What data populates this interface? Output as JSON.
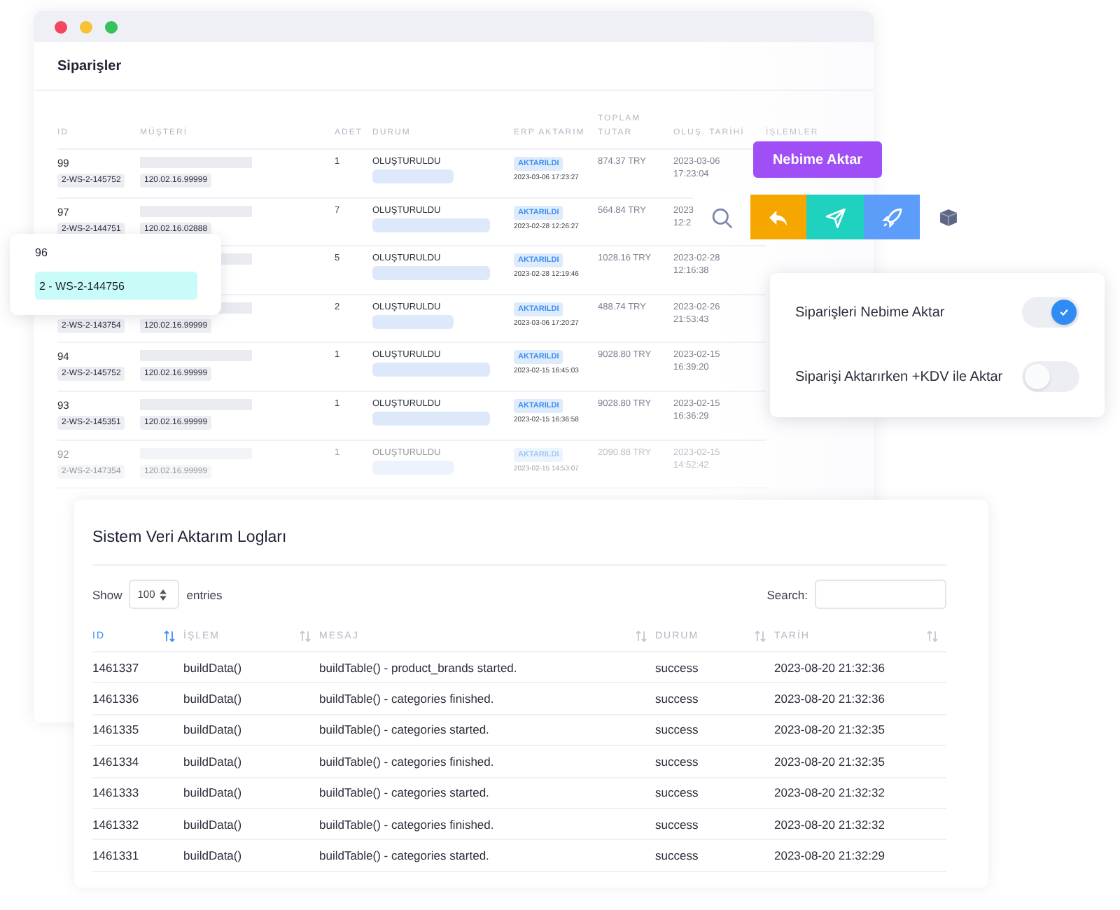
{
  "window": {
    "title": "Siparişler"
  },
  "orders": {
    "columns": [
      "ID",
      "MÜŞTERİ",
      "ADET",
      "DURUM",
      "ERP AKTARIM",
      "TOPLAM TUTAR",
      "OLUŞ. TARİHİ",
      "İŞLEMLER"
    ],
    "rows": [
      {
        "id": "99",
        "code": "2-WS-2-145752",
        "customer_code": "120.02.16.99999",
        "qty": "1",
        "status": "OLUŞTURULDU",
        "erp": "AKTARILDI",
        "erp_date": "2023-03-06 17:23:27",
        "total": "874.37 TRY",
        "created_date": "2023-03-06",
        "created_time": "17:23:04",
        "faded": false
      },
      {
        "id": "97",
        "code": "2-WS-2-144751",
        "customer_code": "120.02.16.02888",
        "qty": "7",
        "status": "OLUŞTURULDU",
        "erp": "AKTARILDI",
        "erp_date": "2023-02-28 12:26:27",
        "total": "564.84 TRY",
        "created_date": "2023",
        "created_time": "12:2",
        "faded": false
      },
      {
        "qty": "5",
        "status": "OLUŞTURULDU",
        "erp": "AKTARILDI",
        "erp_date": "2023-02-28 12:19:46",
        "total": "1028.16 TRY",
        "created_date": "2023-02-28",
        "created_time": "12:16:38",
        "faded": false
      },
      {
        "code": "2-WS-2-143754",
        "customer_code": "120.02.16.99999",
        "qty": "2",
        "status": "OLUŞTURULDU",
        "erp": "AKTARILDI",
        "erp_date": "2023-03-06 17:20:27",
        "total": "488.74 TRY",
        "created_date": "2023-02-26",
        "created_time": "21:53:43",
        "faded": false
      },
      {
        "id": "94",
        "code": "2-WS-2-145752",
        "customer_code": "120.02.16.99999",
        "qty": "1",
        "status": "OLUŞTURULDU",
        "erp": "AKTARILDI",
        "erp_date": "2023-02-15 16:45:03",
        "total": "9028.80 TRY",
        "created_date": "2023-02-15",
        "created_time": "16:39:20",
        "faded": false
      },
      {
        "id": "93",
        "code": "2-WS-2-145351",
        "customer_code": "120.02.16.99999",
        "qty": "1",
        "status": "OLUŞTURULDU",
        "erp": "AKTARILDI",
        "erp_date": "2023-02-15 16:36:58",
        "total": "9028.80 TRY",
        "created_date": "2023-02-15",
        "created_time": "16:36:29",
        "faded": false
      },
      {
        "id": "92",
        "code": "2-WS-2-147354",
        "customer_code": "120.02.16.99999",
        "qty": "1",
        "status": "OLUŞTURULDU",
        "erp": "AKTARILDI",
        "erp_date": "2023-02-15 14:53:07",
        "total": "2090.88 TRY",
        "created_date": "2023-02-15",
        "created_time": "14:52:42",
        "faded": true
      }
    ]
  },
  "popup": {
    "id": "96",
    "code": "2 - WS-2-144756"
  },
  "tooltip": "Nebime Aktar",
  "actions": [
    {
      "kind": "search",
      "color": "#ffffff"
    },
    {
      "kind": "reply",
      "color": "#f5a700"
    },
    {
      "kind": "send",
      "color": "#1fd1bf"
    },
    {
      "kind": "rocket",
      "color": "#5b9df9"
    },
    {
      "kind": "box",
      "color": "#ffffff"
    }
  ],
  "toggles": [
    {
      "label": "Siparişleri Nebime Aktar",
      "on": true
    },
    {
      "label": "Siparişi Aktarırken +KDV ile Aktar",
      "on": false
    }
  ],
  "logs": {
    "title": "Sistem Veri Aktarım Logları",
    "show_label": "Show",
    "page_size": "100",
    "entries_label": "entries",
    "search_label": "Search:",
    "columns": [
      {
        "label": "ID",
        "sorted": true
      },
      {
        "label": "İŞLEM",
        "sorted": false
      },
      {
        "label": "MESAJ",
        "sorted": false
      },
      {
        "label": "DURUM",
        "sorted": false
      },
      {
        "label": "TARİH",
        "sorted": false
      }
    ],
    "rows": [
      [
        "1461337",
        "buildData()",
        "buildTable() - product_brands started.",
        "success",
        "2023-08-20 21:32:36"
      ],
      [
        "1461336",
        "buildData()",
        "buildTable() - categories finished.",
        "success",
        "2023-08-20 21:32:36"
      ],
      [
        "1461335",
        "buildData()",
        "buildTable() - categories started.",
        "success",
        "2023-08-20 21:32:35"
      ],
      [
        "1461334",
        "buildData()",
        "buildTable() - categories finished.",
        "success",
        "2023-08-20 21:32:35"
      ],
      [
        "1461333",
        "buildData()",
        "buildTable() - categories started.",
        "success",
        "2023-08-20 21:32:32"
      ],
      [
        "1461332",
        "buildData()",
        "buildTable() - categories finished.",
        "success",
        "2023-08-20 21:32:32"
      ],
      [
        "1461331",
        "buildData()",
        "buildTable() - categories started.",
        "success",
        "2023-08-20 21:32:29"
      ]
    ]
  }
}
